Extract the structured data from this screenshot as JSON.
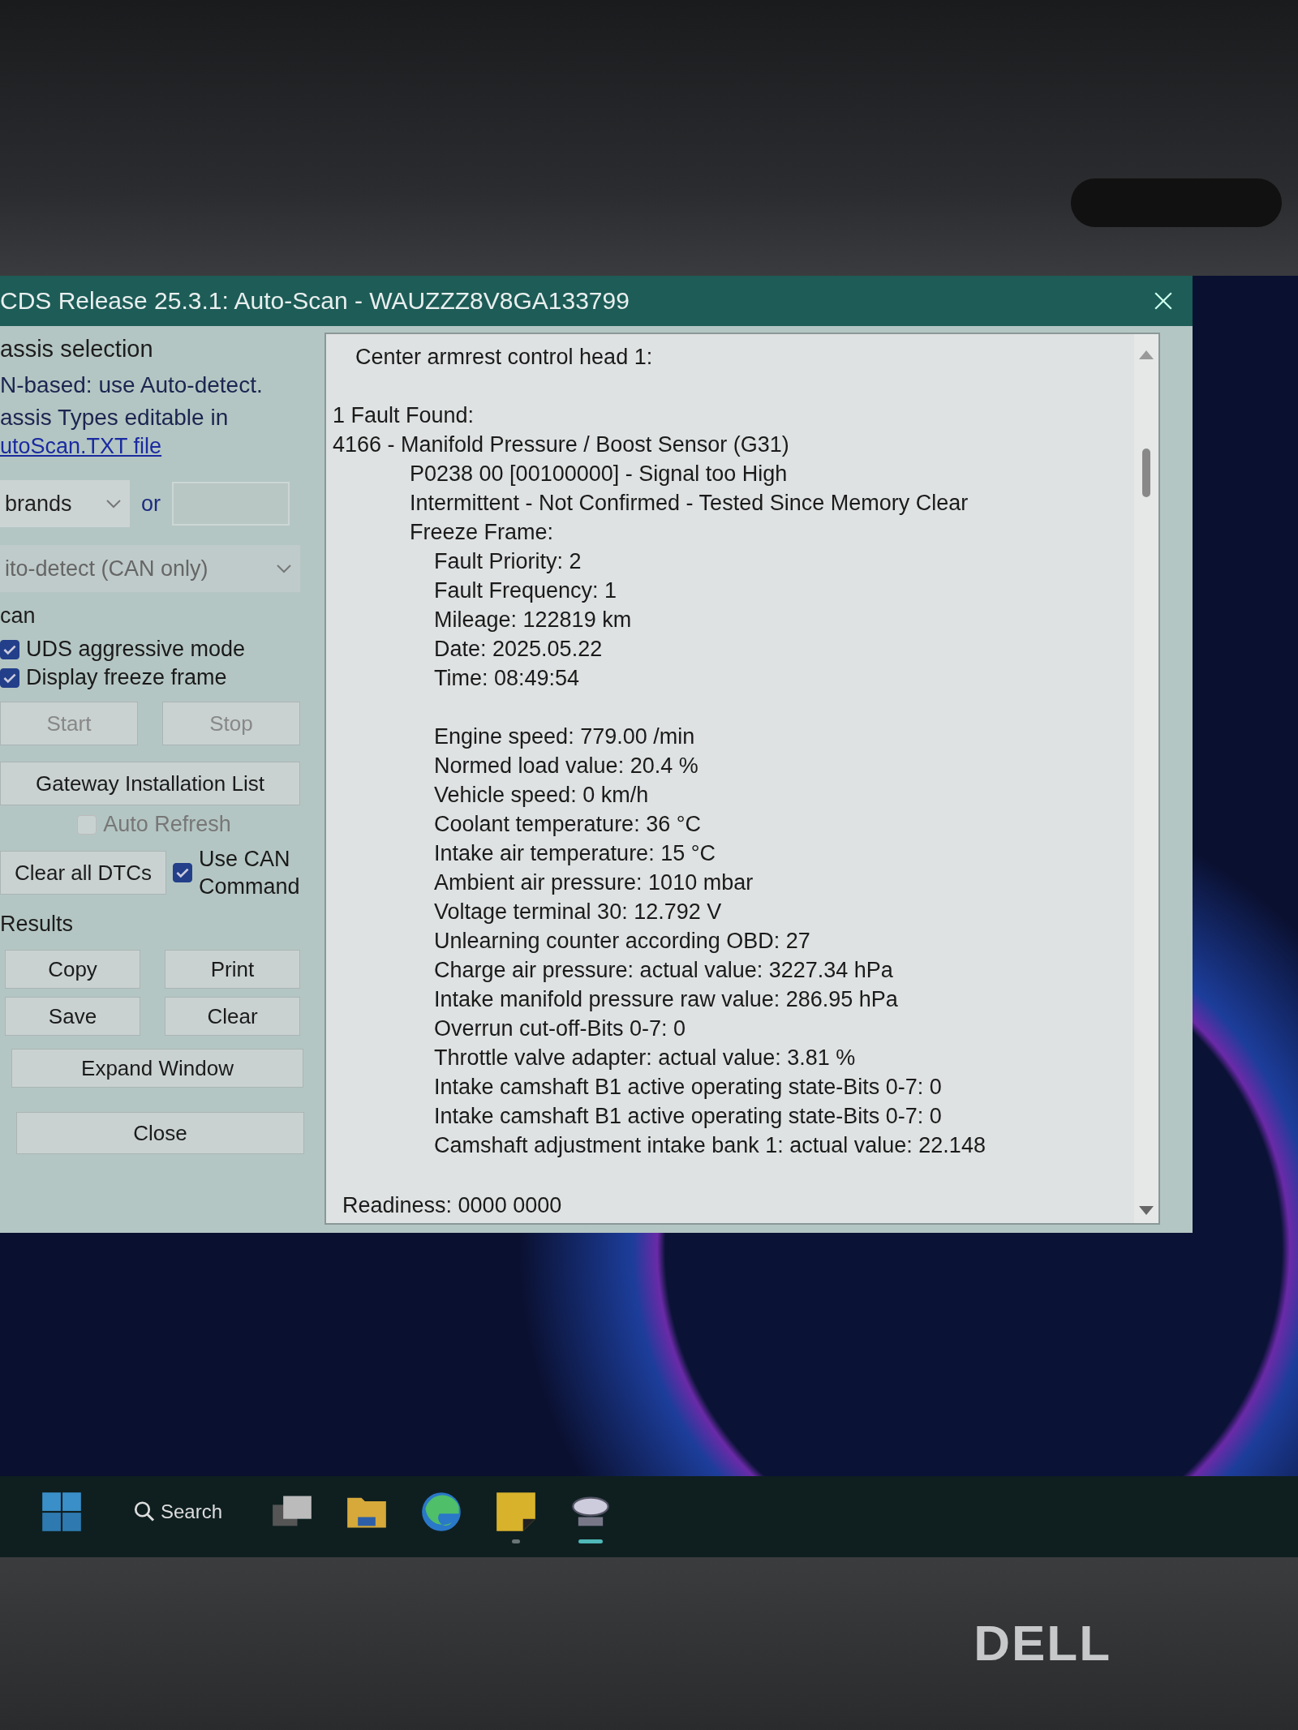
{
  "window": {
    "title": "CDS Release 25.3.1:  Auto-Scan - WAUZZZ8V8GA133799"
  },
  "left_panel": {
    "section_title": "assis selection",
    "info_lines": [
      "N-based: use Auto-detect.",
      "assis Types editable in"
    ],
    "link": "utoScan.TXT file",
    "brand_select": {
      "value": "brands"
    },
    "or_label": "or",
    "detect_select": {
      "value": "ito-detect (CAN only)",
      "disabled": true
    },
    "scan_label": "can",
    "options": [
      {
        "label": "UDS aggressive mode",
        "checked": true
      },
      {
        "label": "Display freeze frame",
        "checked": true
      }
    ],
    "scan_buttons": [
      {
        "label": "Start",
        "disabled": true
      },
      {
        "label": "Stop",
        "disabled": true
      }
    ],
    "gateway_button": {
      "label": "Gateway Installation List"
    },
    "auto_refresh": {
      "label": "Auto Refresh",
      "checked": false,
      "disabled": true
    },
    "clear_button": {
      "label": "Clear all DTCs"
    },
    "use_can": {
      "label": "Use CAN Command",
      "checked": true
    },
    "results_label": "Results",
    "result_buttons": [
      {
        "label": "Copy"
      },
      {
        "label": "Print"
      },
      {
        "label": "Save"
      },
      {
        "label": "Clear"
      }
    ],
    "expand_button": {
      "label": "Expand Window"
    },
    "close_button": {
      "label": "Close"
    }
  },
  "report": {
    "header": "Center armrest control head 1:",
    "lines": [
      {
        "kind": "spacer"
      },
      {
        "kind": "text",
        "text": "1 Fault Found:"
      },
      {
        "kind": "text",
        "text": "4166 - Manifold Pressure / Boost Sensor (G31)",
        "children": [
          {
            "kind": "text",
            "text": "P0238 00 [00100000] - Signal too High"
          },
          {
            "kind": "text",
            "text": "Intermittent - Not Confirmed - Tested Since Memory Clear"
          },
          {
            "kind": "text",
            "text": "Freeze Frame:",
            "children": [
              {
                "kind": "text",
                "text": "Fault Priority: 2"
              },
              {
                "kind": "text",
                "text": "Fault Frequency: 1"
              },
              {
                "kind": "text",
                "text": "Mileage: 122819 km"
              },
              {
                "kind": "text",
                "text": "Date: 2025.05.22"
              },
              {
                "kind": "text",
                "text": "Time: 08:49:54"
              },
              {
                "kind": "spacer"
              },
              {
                "kind": "text",
                "text": "Engine speed: 779.00 /min"
              },
              {
                "kind": "text",
                "text": "Normed load value: 20.4 %"
              },
              {
                "kind": "text",
                "text": "Vehicle speed: 0 km/h"
              },
              {
                "kind": "text",
                "text": "Coolant temperature: 36 °C"
              },
              {
                "kind": "text",
                "text": "Intake air temperature: 15 °C"
              },
              {
                "kind": "text",
                "text": "Ambient air pressure: 1010 mbar"
              },
              {
                "kind": "text",
                "text": "Voltage terminal 30: 12.792 V"
              },
              {
                "kind": "text",
                "text": "Unlearning counter according OBD: 27"
              },
              {
                "kind": "text",
                "text": "Charge air pressure: actual value: 3227.34 hPa"
              },
              {
                "kind": "text",
                "text": "Intake manifold pressure raw value: 286.95 hPa"
              },
              {
                "kind": "text",
                "text": "Overrun cut-off-Bits 0-7: 0"
              },
              {
                "kind": "text",
                "text": "Throttle valve adapter: actual value: 3.81 %"
              },
              {
                "kind": "text",
                "text": "Intake camshaft B1 active operating state-Bits 0-7: 0"
              },
              {
                "kind": "text",
                "text": "Intake camshaft B1 active operating state-Bits 0-7: 0"
              },
              {
                "kind": "text",
                "text": "Camshaft adjustment intake bank 1: actual value: 22.148"
              }
            ]
          }
        ]
      }
    ],
    "footer": "Readiness: 0000 0000"
  },
  "taskbar": {
    "apps": [
      {
        "kind": "start",
        "running": false,
        "active": false
      },
      {
        "kind": "search",
        "label": "Search",
        "running": false,
        "active": false
      },
      {
        "kind": "taskview",
        "running": false,
        "active": false
      },
      {
        "kind": "folder",
        "running": false,
        "active": false
      },
      {
        "kind": "browser",
        "running": false,
        "active": false
      },
      {
        "kind": "notes",
        "running": true,
        "active": false
      },
      {
        "kind": "app",
        "running": true,
        "active": true
      }
    ]
  },
  "bezel": {
    "logo": "DELL"
  }
}
